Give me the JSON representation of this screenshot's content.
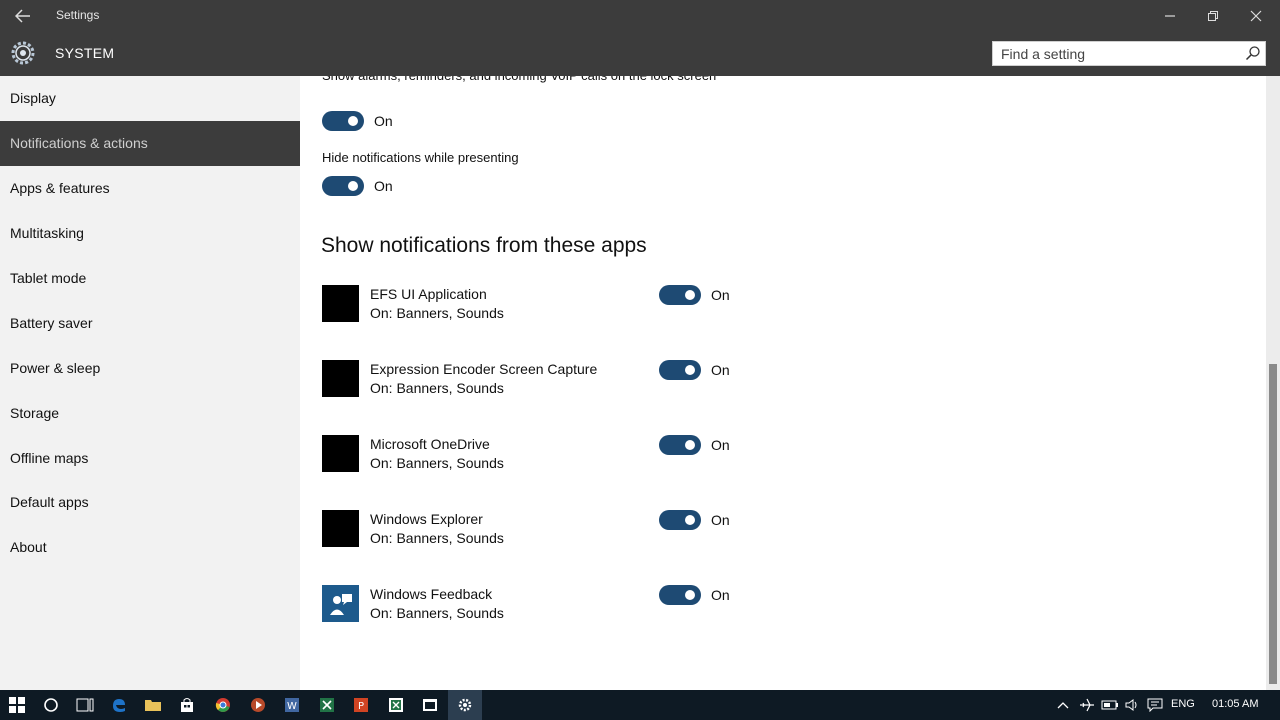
{
  "window": {
    "app_title": "Settings",
    "section_title": "SYSTEM"
  },
  "search": {
    "placeholder": "Find a setting"
  },
  "sidebar": {
    "items": [
      {
        "label": "Display",
        "active": false
      },
      {
        "label": "Notifications & actions",
        "active": true
      },
      {
        "label": "Apps & features",
        "active": false
      },
      {
        "label": "Multitasking",
        "active": false
      },
      {
        "label": "Tablet mode",
        "active": false
      },
      {
        "label": "Battery saver",
        "active": false
      },
      {
        "label": "Power & sleep",
        "active": false
      },
      {
        "label": "Storage",
        "active": false
      },
      {
        "label": "Offline maps",
        "active": false
      },
      {
        "label": "Default apps",
        "active": false
      },
      {
        "label": "About",
        "active": false
      }
    ]
  },
  "settings": {
    "lock_screen_text": "Show alarms, reminders, and incoming VoIP calls on the lock screen",
    "lock_screen_state": "On",
    "presenting_text": "Hide notifications while presenting",
    "presenting_state": "On"
  },
  "apps_section": {
    "heading": "Show notifications from these apps",
    "apps": [
      {
        "name": "EFS UI Application",
        "detail": "On: Banners, Sounds",
        "state": "On",
        "icon": "black-square-icon"
      },
      {
        "name": "Expression Encoder Screen Capture",
        "detail": "On: Banners, Sounds",
        "state": "On",
        "icon": "black-square-icon"
      },
      {
        "name": "Microsoft OneDrive",
        "detail": "On: Banners, Sounds",
        "state": "On",
        "icon": "black-square-icon"
      },
      {
        "name": "Windows Explorer",
        "detail": "On: Banners, Sounds",
        "state": "On",
        "icon": "black-square-icon"
      },
      {
        "name": "Windows Feedback",
        "detail": "On: Banners, Sounds",
        "state": "On",
        "icon": "feedback-icon"
      }
    ]
  },
  "taskbar": {
    "language": "ENG",
    "time": "01:05 AM"
  },
  "colors": {
    "accent": "#1e4a73",
    "header": "#3c3c3c",
    "sidebar": "#f2f2f2",
    "taskbar": "#0e1a24"
  }
}
